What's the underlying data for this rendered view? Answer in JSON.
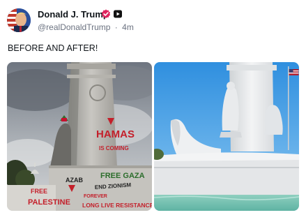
{
  "post": {
    "author_name": "Donald J. Trump",
    "handle": "@realDonaldTrump",
    "separator": "·",
    "timestamp": "4m",
    "text": "BEFORE AND AFTER!",
    "icons": {
      "verified": "verified-badge-icon",
      "platform": "video-platform-icon"
    },
    "colors": {
      "verified_badge": "#e0245e",
      "handle_text": "#6b7280"
    }
  },
  "images": {
    "before": {
      "graffiti": [
        "HAMAS",
        "IS COMING",
        "AZAB",
        "FREE GAZA",
        "FREE",
        "PALESTINE",
        "END ZIONISM",
        "FOREVER",
        "LONG LIVE RESISTANCE"
      ]
    },
    "after": {}
  }
}
